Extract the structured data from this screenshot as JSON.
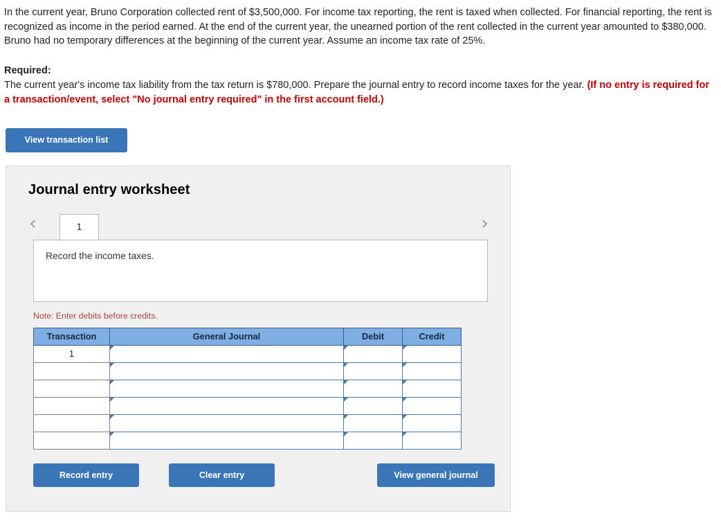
{
  "problem": {
    "text": "In the current year, Bruno Corporation collected rent of $3,500,000. For income tax reporting, the rent is taxed when collected. For financial reporting, the rent is recognized as income in the period earned. At the end of the current year, the unearned portion of the rent collected in the current year amounted to $380,000. Bruno had no temporary differences at the beginning of the current year. Assume an income tax rate of 25%."
  },
  "required": {
    "label": "Required:",
    "text": "The current year's income tax liability from the tax return is $780,000. Prepare the journal entry to record income taxes for the year.",
    "emphasis": "(If no entry is required for a transaction/event, select \"No journal entry required\" in the first account field.)"
  },
  "toolbar": {
    "view_transaction_list": "View transaction list"
  },
  "worksheet": {
    "title": "Journal entry worksheet",
    "prev_arrow": "‹",
    "next_arrow": "›",
    "tabs": [
      {
        "label": "1",
        "active": true
      }
    ],
    "description": "Record the income taxes.",
    "note": "Note: Enter debits before credits."
  },
  "table": {
    "headers": [
      "Transaction",
      "General Journal",
      "Debit",
      "Credit"
    ],
    "rows": [
      {
        "transaction": "1",
        "general_journal": "",
        "debit": "",
        "credit": ""
      },
      {
        "transaction": "",
        "general_journal": "",
        "debit": "",
        "credit": ""
      },
      {
        "transaction": "",
        "general_journal": "",
        "debit": "",
        "credit": ""
      },
      {
        "transaction": "",
        "general_journal": "",
        "debit": "",
        "credit": ""
      },
      {
        "transaction": "",
        "general_journal": "",
        "debit": "",
        "credit": ""
      },
      {
        "transaction": "",
        "general_journal": "",
        "debit": "",
        "credit": ""
      }
    ]
  },
  "actions": {
    "record_entry": "Record entry",
    "clear_entry": "Clear entry",
    "view_general_journal": "View general journal"
  },
  "colors": {
    "button_blue": "#3975b7",
    "table_header_blue": "#7eaee4",
    "panel_gray": "#f0f0f0",
    "alert_red": "#c00000",
    "note_red": "#a9453f"
  }
}
